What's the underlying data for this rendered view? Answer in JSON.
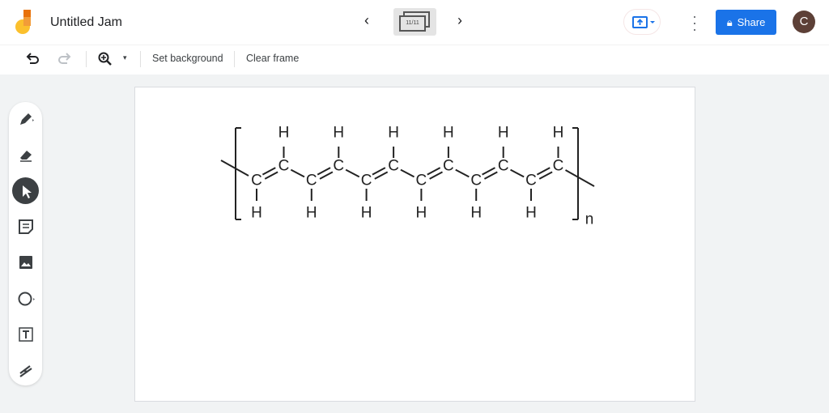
{
  "header": {
    "title": "Untitled Jam",
    "frame_counter": "11/11",
    "share_label": "Share",
    "avatar_initial": "C"
  },
  "toolbar": {
    "set_background": "Set background",
    "clear_frame": "Clear frame"
  },
  "sidebar": {
    "tools": [
      "pen",
      "eraser",
      "select",
      "sticky-note",
      "image",
      "circle",
      "text-box",
      "laser"
    ],
    "active": "select"
  },
  "molecule": {
    "repeat_units": 6,
    "carbon": "C",
    "hydrogen": "H",
    "subscript": "n"
  },
  "colors": {
    "accent": "#1a73e8",
    "avatar": "#5d4037"
  }
}
